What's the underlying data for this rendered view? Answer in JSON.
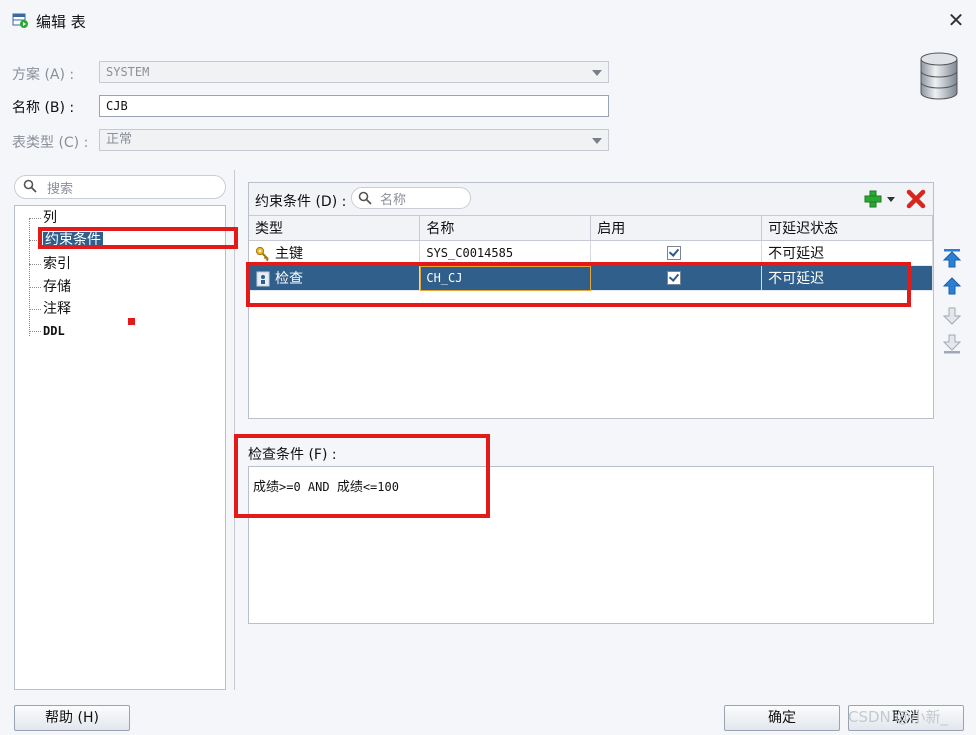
{
  "window": {
    "title": "编辑 表",
    "close_icon": "close-icon"
  },
  "form": {
    "schema": {
      "label": "方案 (A) :",
      "value": "SYSTEM"
    },
    "name": {
      "label": "名称 (B) :",
      "value": "CJB"
    },
    "table_type": {
      "label": "表类型 (C) :",
      "value": "正常"
    }
  },
  "sidebar": {
    "search_placeholder": "搜索",
    "items": [
      {
        "label": "列"
      },
      {
        "label": "约束条件",
        "selected": true
      },
      {
        "label": "索引"
      },
      {
        "label": "存储"
      },
      {
        "label": "注释"
      },
      {
        "label": "DDL"
      }
    ]
  },
  "constraints": {
    "label": "约束条件 (D) :",
    "search_placeholder": "名称",
    "columns": [
      "类型",
      "名称",
      "启用",
      "可延迟状态"
    ],
    "rows": [
      {
        "type": "主键",
        "name": "SYS_C0014585",
        "enabled": true,
        "deferrable": "不可延迟",
        "icon": "key-icon"
      },
      {
        "type": "检查",
        "name": "CH_CJ",
        "enabled": true,
        "deferrable": "不可延迟",
        "icon": "check-constraint-icon",
        "selected": true
      }
    ]
  },
  "check_condition": {
    "label": "检查条件 (F) :",
    "text_a": "成绩",
    "text_b": ">=0 AND ",
    "text_c": "成绩",
    "text_d": "<=100"
  },
  "buttons": {
    "help": "帮助 (H)",
    "ok": "确定",
    "cancel": "取消"
  },
  "watermark": "CSDN @小新_",
  "colors": {
    "selection": "#2f5f8a",
    "highlight": "#e21a1a",
    "add": "#2aa832",
    "delete": "#d8261c",
    "arrow_blue": "#2b7fd4"
  }
}
